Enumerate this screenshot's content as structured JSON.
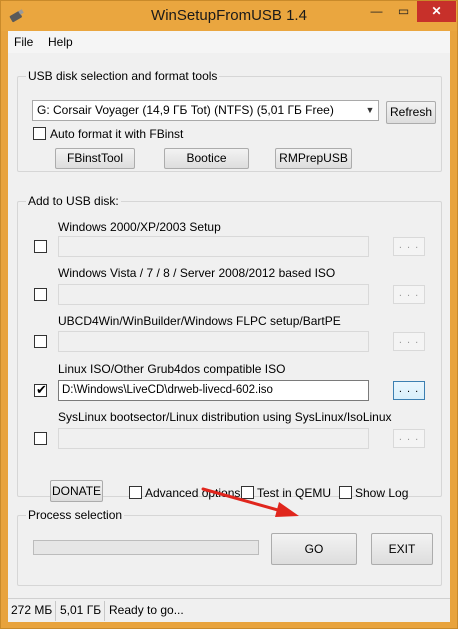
{
  "window": {
    "title": "WinSetupFromUSB 1.4",
    "controls": {
      "minimize": "—",
      "maximize": "▭",
      "close": "✕"
    }
  },
  "menu": [
    "File",
    "Help"
  ],
  "usb_group": {
    "title": "USB disk selection and format tools",
    "disk_selected": "G: Corsair Voyager (14,9 ГБ Tot) (NTFS) (5,01 ГБ Free)",
    "refresh": "Refresh",
    "auto_format": {
      "label": "Auto format it with FBinst",
      "checked": false
    },
    "tools": [
      "FBinstTool",
      "Bootice",
      "RMPrepUSB"
    ]
  },
  "add_group": {
    "title": "Add to USB disk:",
    "sources": [
      {
        "label": "Windows 2000/XP/2003 Setup",
        "checked": false,
        "path": "",
        "browse": ". . ."
      },
      {
        "label": "Windows Vista / 7 / 8 / Server 2008/2012 based ISO",
        "checked": false,
        "path": "",
        "browse": ". . ."
      },
      {
        "label": "UBCD4Win/WinBuilder/Windows FLPC setup/BartPE",
        "checked": false,
        "path": "",
        "browse": ". . ."
      },
      {
        "label": "Linux ISO/Other Grub4dos compatible ISO",
        "checked": true,
        "path": "D:\\Windows\\LiveCD\\drweb-livecd-602.iso",
        "browse": ". . ."
      },
      {
        "label": "SysLinux bootsector/Linux distribution using SysLinux/IsoLinux",
        "checked": false,
        "path": "",
        "browse": ". . ."
      }
    ]
  },
  "options": {
    "donate": "DONATE",
    "advanced": {
      "label": "Advanced options",
      "checked": false
    },
    "qemu": {
      "label": "Test in QEMU",
      "checked": false
    },
    "showlog": {
      "label": "Show Log",
      "checked": false
    }
  },
  "process": {
    "title": "Process selection",
    "progress": 0,
    "go": "GO",
    "exit": "EXIT"
  },
  "status": [
    "272 МБ",
    "5,01 ГБ",
    "Ready to go..."
  ],
  "colors": {
    "title_bar": "#eaa63f",
    "close_button": "#c7302a",
    "annotation_arrow": "#e0261d"
  }
}
